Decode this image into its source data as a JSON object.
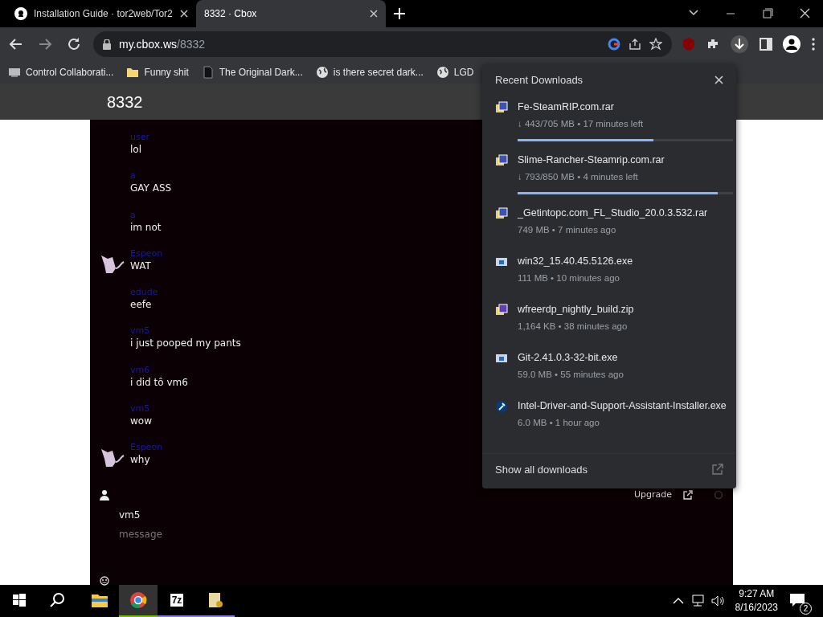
{
  "browser": {
    "tabs": [
      {
        "title": "Installation Guide · tor2web/Tor2",
        "selected": false
      },
      {
        "title": "8332 · Cbox",
        "selected": true
      }
    ],
    "url_host": "my.cbox.ws",
    "url_path": "/8332",
    "bookmarks": [
      {
        "kind": "app",
        "label": "Control Collaborati..."
      },
      {
        "kind": "folder",
        "label": "Funny shit"
      },
      {
        "kind": "page",
        "label": "The Original Dark..."
      },
      {
        "kind": "globe",
        "label": "is there secret dark..."
      },
      {
        "kind": "globe",
        "label": "LGD"
      }
    ]
  },
  "chat": {
    "title": "8332",
    "messages": [
      {
        "user": "user",
        "text": "lol",
        "avatar": false
      },
      {
        "user": "a",
        "text": "GAY ASS",
        "avatar": false
      },
      {
        "user": "a",
        "text": "im not",
        "avatar": false
      },
      {
        "user": "Espeon",
        "text": "WAT",
        "avatar": true
      },
      {
        "user": "edude",
        "text": "eefe",
        "avatar": false
      },
      {
        "user": "vm5",
        "text": "i just pooped my pants",
        "avatar": false
      },
      {
        "user": "vm6",
        "text": "i did tô vm6",
        "avatar": false
      },
      {
        "user": "vm5",
        "text": "wow",
        "avatar": false
      },
      {
        "user": "Espeon",
        "text": "why",
        "avatar": true
      }
    ],
    "upgrade": "Upgrade",
    "composer": {
      "name": "vm5",
      "placeholder": "message"
    }
  },
  "downloads": {
    "title": "Recent Downloads",
    "items": [
      {
        "kind": "archive",
        "name": "Fe-SteamRIP.com.rar",
        "status": "↓ 443/705 MB • 17 minutes left",
        "level": 0.63
      },
      {
        "kind": "archive",
        "name": "Slime-Rancher-Steamrip.com.rar",
        "status": "↓ 793/850 MB • 4 minutes left",
        "level": 0.93
      },
      {
        "kind": "archive",
        "name": "_Getintopc.com_FL_Studio_20.0.3.532.rar",
        "status": "749 MB • 7 minutes ago"
      },
      {
        "kind": "program",
        "name": "win32_15.40.45.5126.exe",
        "status": "111 MB • 10 minutes ago"
      },
      {
        "kind": "zip",
        "name": "wfreerdp_nightly_build.zip",
        "status": "1,164 KB • 38 minutes ago"
      },
      {
        "kind": "program",
        "name": "Git-2.41.0.3-32-bit.exe",
        "status": "59.0 MB • 55 minutes ago"
      },
      {
        "kind": "installer",
        "name": "Intel-Driver-and-Support-Assistant-Installer.exe",
        "status": "6.0 MB • 1 hour ago"
      }
    ],
    "show_all": "Show all downloads"
  },
  "taskbar": {
    "apps": [
      {
        "kind": "folder",
        "running": false,
        "selected": false
      },
      {
        "kind": "chrome",
        "running": true,
        "selected": true
      },
      {
        "kind": "archiver",
        "label": "7z",
        "running": true,
        "selected": false
      },
      {
        "kind": "setup",
        "running": true,
        "selected": false
      }
    ],
    "time": "9:27 AM",
    "date": "8/16/2023",
    "notifications": "2"
  }
}
